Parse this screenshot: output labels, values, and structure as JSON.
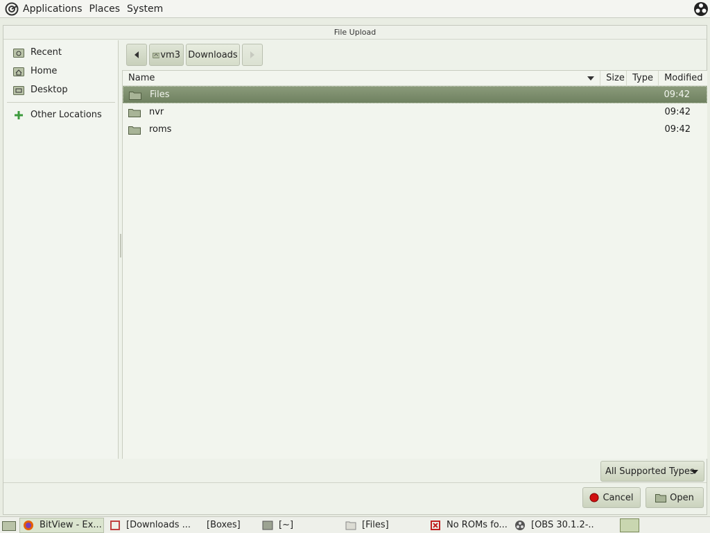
{
  "top_panel": {
    "menus": [
      "Applications",
      "Places",
      "System"
    ]
  },
  "dialog": {
    "title": "File Upload",
    "sidebar": {
      "items": [
        {
          "label": "Recent",
          "icon": "recent-folder-icon"
        },
        {
          "label": "Home",
          "icon": "home-folder-icon"
        },
        {
          "label": "Desktop",
          "icon": "desktop-folder-icon"
        }
      ],
      "other_locations": {
        "label": "Other Locations",
        "icon": "plus-icon"
      }
    },
    "pathbar": {
      "back_icon": "chevron-left-icon",
      "crumbs": [
        "vm3",
        "Downloads"
      ],
      "forward_icon": "chevron-right-icon"
    },
    "columns": {
      "name": "Name",
      "size": "Size",
      "type": "Type",
      "modified": "Modified"
    },
    "files": [
      {
        "name": "Files",
        "modified": "09:42",
        "selected": true
      },
      {
        "name": "nvr",
        "modified": "09:42",
        "selected": false
      },
      {
        "name": "roms",
        "modified": "09:42",
        "selected": false
      }
    ],
    "filter": "All Supported Types",
    "buttons": {
      "cancel": "Cancel",
      "open": "Open"
    }
  },
  "taskbar": {
    "tasks": [
      {
        "label": "BitView - Ex...",
        "active": true,
        "icon": "firefox-icon"
      },
      {
        "label": "[Downloads ...",
        "active": false,
        "icon": "app-icon"
      },
      {
        "label": "[Boxes]",
        "active": false,
        "icon": ""
      },
      {
        "label": "[~]",
        "active": false,
        "icon": "terminal-icon"
      },
      {
        "label": "[Files]",
        "active": false,
        "icon": "folder-icon"
      },
      {
        "label": "No ROMs fo...",
        "active": false,
        "icon": "app-icon"
      },
      {
        "label": "[OBS 30.1.2-...",
        "active": false,
        "icon": "obs-icon"
      }
    ]
  },
  "colors": {
    "selection": "#7d8f6c",
    "background": "#eef2ea"
  }
}
